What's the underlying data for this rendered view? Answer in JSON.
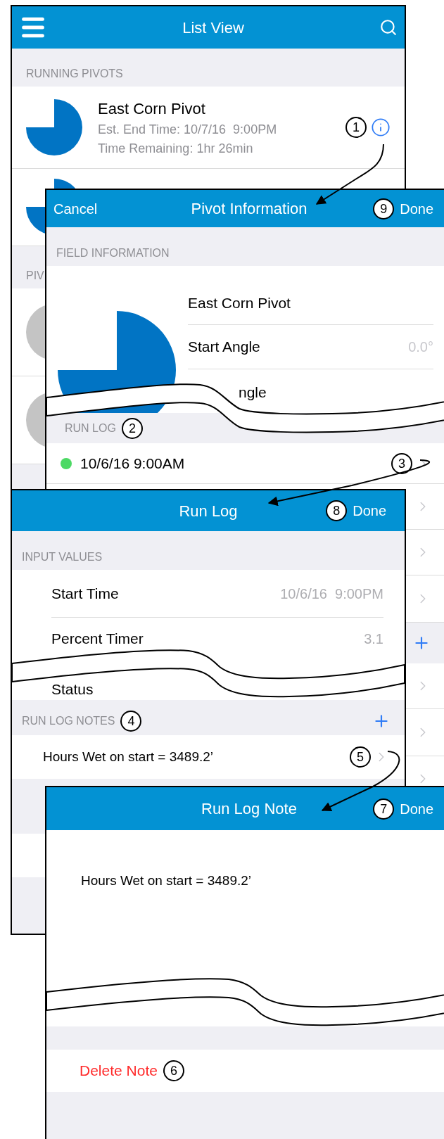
{
  "list_view": {
    "title": "List View",
    "section": "RUNNING PIVOTS",
    "pivots": [
      {
        "name": "East Corn Pivot",
        "end_time": "Est. End Time: 10/7/16  9:00PM",
        "remaining": "Time Remaining: 1hr 26min",
        "callout": "1"
      }
    ],
    "section_2": "PIV"
  },
  "pivot_info": {
    "cancel": "Cancel",
    "title": "Pivot Information",
    "callout": "9",
    "done": "Done",
    "section": "FIELD INFORMATION",
    "pivot_name": "East Corn Pivot",
    "fields": [
      {
        "kind": "full",
        "label": "Start Angle",
        "value": "0.0°"
      },
      {
        "kind": "cut",
        "label": "ngle"
      }
    ],
    "run_log_label": "RUN LOG",
    "run_log_callout": "2",
    "entries": [
      {
        "time": "10/6/16 9:00AM",
        "color": "#4cd964",
        "callout": "3"
      }
    ]
  },
  "run_log": {
    "title": "Run Log",
    "callout": "8",
    "done": "Done",
    "section": "INPUT VALUES",
    "fields": [
      {
        "label": "Start Time",
        "value": "10/6/16  9:00PM"
      },
      {
        "label": "Percent Timer",
        "value": "3.1"
      },
      {
        "label": "Status"
      }
    ],
    "notes_label": "RUN LOG NOTES",
    "notes_callout": "4",
    "notes": [
      {
        "text": "Hours Wet on start = 3489.2’",
        "callout": "5"
      }
    ]
  },
  "run_log_note": {
    "title": "Run Log Note",
    "callout": "7",
    "done": "Done",
    "text": "Hours Wet on start = 3489.2’",
    "delete": "Delete Note",
    "delete_callout": "6"
  }
}
